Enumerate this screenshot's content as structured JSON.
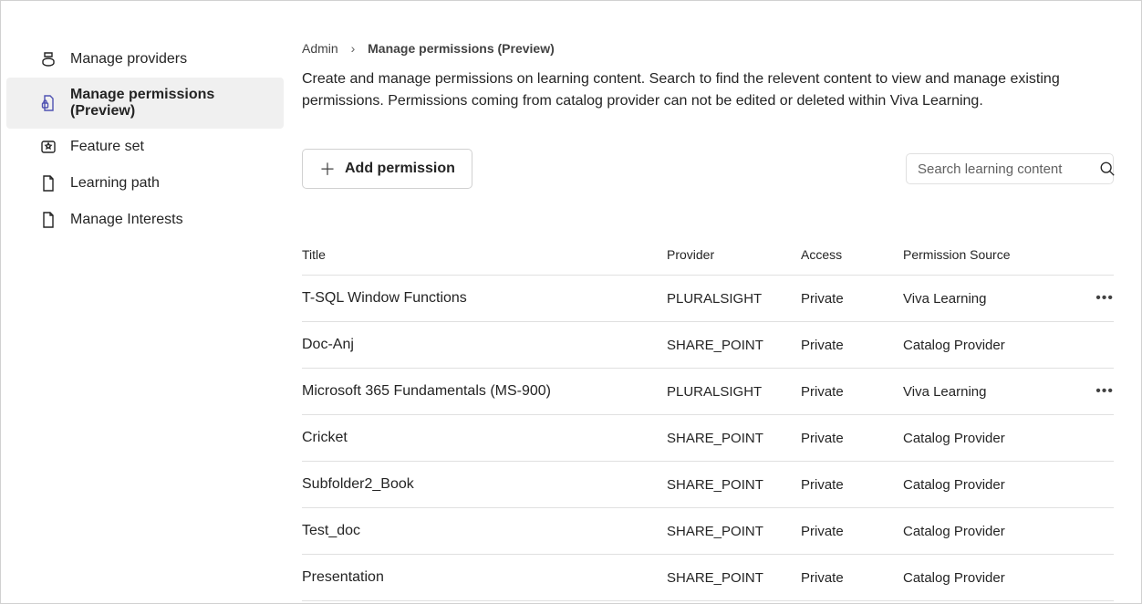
{
  "sidebar": {
    "items": [
      {
        "label": "Manage providers",
        "icon": "providers-icon",
        "active": false
      },
      {
        "label": "Manage permissions (Preview)",
        "icon": "permissions-icon",
        "active": true
      },
      {
        "label": "Feature set",
        "icon": "feature-icon",
        "active": false
      },
      {
        "label": "Learning path",
        "icon": "document-icon",
        "active": false
      },
      {
        "label": "Manage Interests",
        "icon": "document-icon",
        "active": false
      }
    ]
  },
  "breadcrumb": {
    "parent": "Admin",
    "current": "Manage permissions (Preview)"
  },
  "description": "Create and manage permissions on learning content. Search to find the relevent content to view and manage existing permissions. Permissions coming from catalog provider can not be edited or deleted within Viva Learning.",
  "toolbar": {
    "add_label": "Add permission",
    "search_placeholder": "Search learning content"
  },
  "table": {
    "headers": {
      "title": "Title",
      "provider": "Provider",
      "access": "Access",
      "source": "Permission Source"
    },
    "rows": [
      {
        "title": "T-SQL Window Functions",
        "provider": "PLURALSIGHT",
        "access": "Private",
        "source": "Viva Learning",
        "more": true
      },
      {
        "title": "Doc-Anj",
        "provider": "SHARE_POINT",
        "access": "Private",
        "source": "Catalog Provider",
        "more": false
      },
      {
        "title": "Microsoft 365 Fundamentals (MS-900)",
        "provider": "PLURALSIGHT",
        "access": "Private",
        "source": "Viva Learning",
        "more": true
      },
      {
        "title": "Cricket",
        "provider": "SHARE_POINT",
        "access": "Private",
        "source": "Catalog Provider",
        "more": false
      },
      {
        "title": "Subfolder2_Book",
        "provider": "SHARE_POINT",
        "access": "Private",
        "source": "Catalog Provider",
        "more": false
      },
      {
        "title": "Test_doc",
        "provider": "SHARE_POINT",
        "access": "Private",
        "source": "Catalog Provider",
        "more": false
      },
      {
        "title": "Presentation",
        "provider": "SHARE_POINT",
        "access": "Private",
        "source": "Catalog Provider",
        "more": false
      }
    ]
  }
}
